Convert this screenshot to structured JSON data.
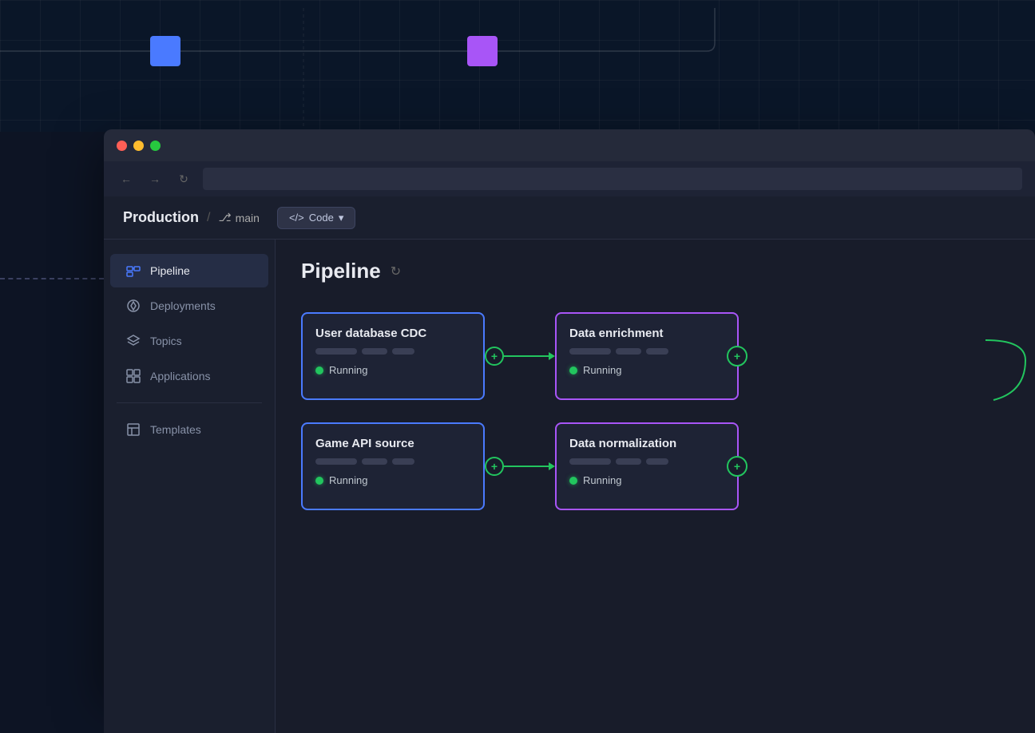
{
  "background": {
    "node_blue_color": "#4a7aff",
    "node_purple_color": "#a855f7"
  },
  "browser": {
    "traffic_lights": [
      "red",
      "yellow",
      "green"
    ]
  },
  "breadcrumb": {
    "project": "Production",
    "separator": "/",
    "branch_icon": "⎇",
    "branch": "main",
    "code_label": "<> Code"
  },
  "sidebar": {
    "items": [
      {
        "id": "pipeline",
        "label": "Pipeline",
        "active": true
      },
      {
        "id": "deployments",
        "label": "Deployments",
        "active": false
      },
      {
        "id": "topics",
        "label": "Topics",
        "active": false
      },
      {
        "id": "applications",
        "label": "Applications",
        "active": false
      }
    ],
    "divider": true,
    "bottom_items": [
      {
        "id": "templates",
        "label": "Templates",
        "active": false
      }
    ]
  },
  "main": {
    "title": "Pipeline",
    "refresh_icon": "↻"
  },
  "pipeline": {
    "nodes": [
      {
        "id": "user-db-cdc",
        "title": "User database CDC",
        "border_color": "blue",
        "status": "Running",
        "tags": [
          "long",
          "med",
          "short"
        ]
      },
      {
        "id": "data-enrichment",
        "title": "Data enrichment",
        "border_color": "purple",
        "status": "Running",
        "tags": [
          "long",
          "med",
          "short"
        ]
      },
      {
        "id": "game-api-source",
        "title": "Game API source",
        "border_color": "blue",
        "status": "Running",
        "tags": [
          "long",
          "med",
          "short"
        ]
      },
      {
        "id": "data-normalization",
        "title": "Data normalization",
        "border_color": "purple",
        "status": "Running",
        "tags": [
          "long",
          "med",
          "short"
        ]
      }
    ],
    "connector_plus": "+",
    "status_running": "Running"
  }
}
